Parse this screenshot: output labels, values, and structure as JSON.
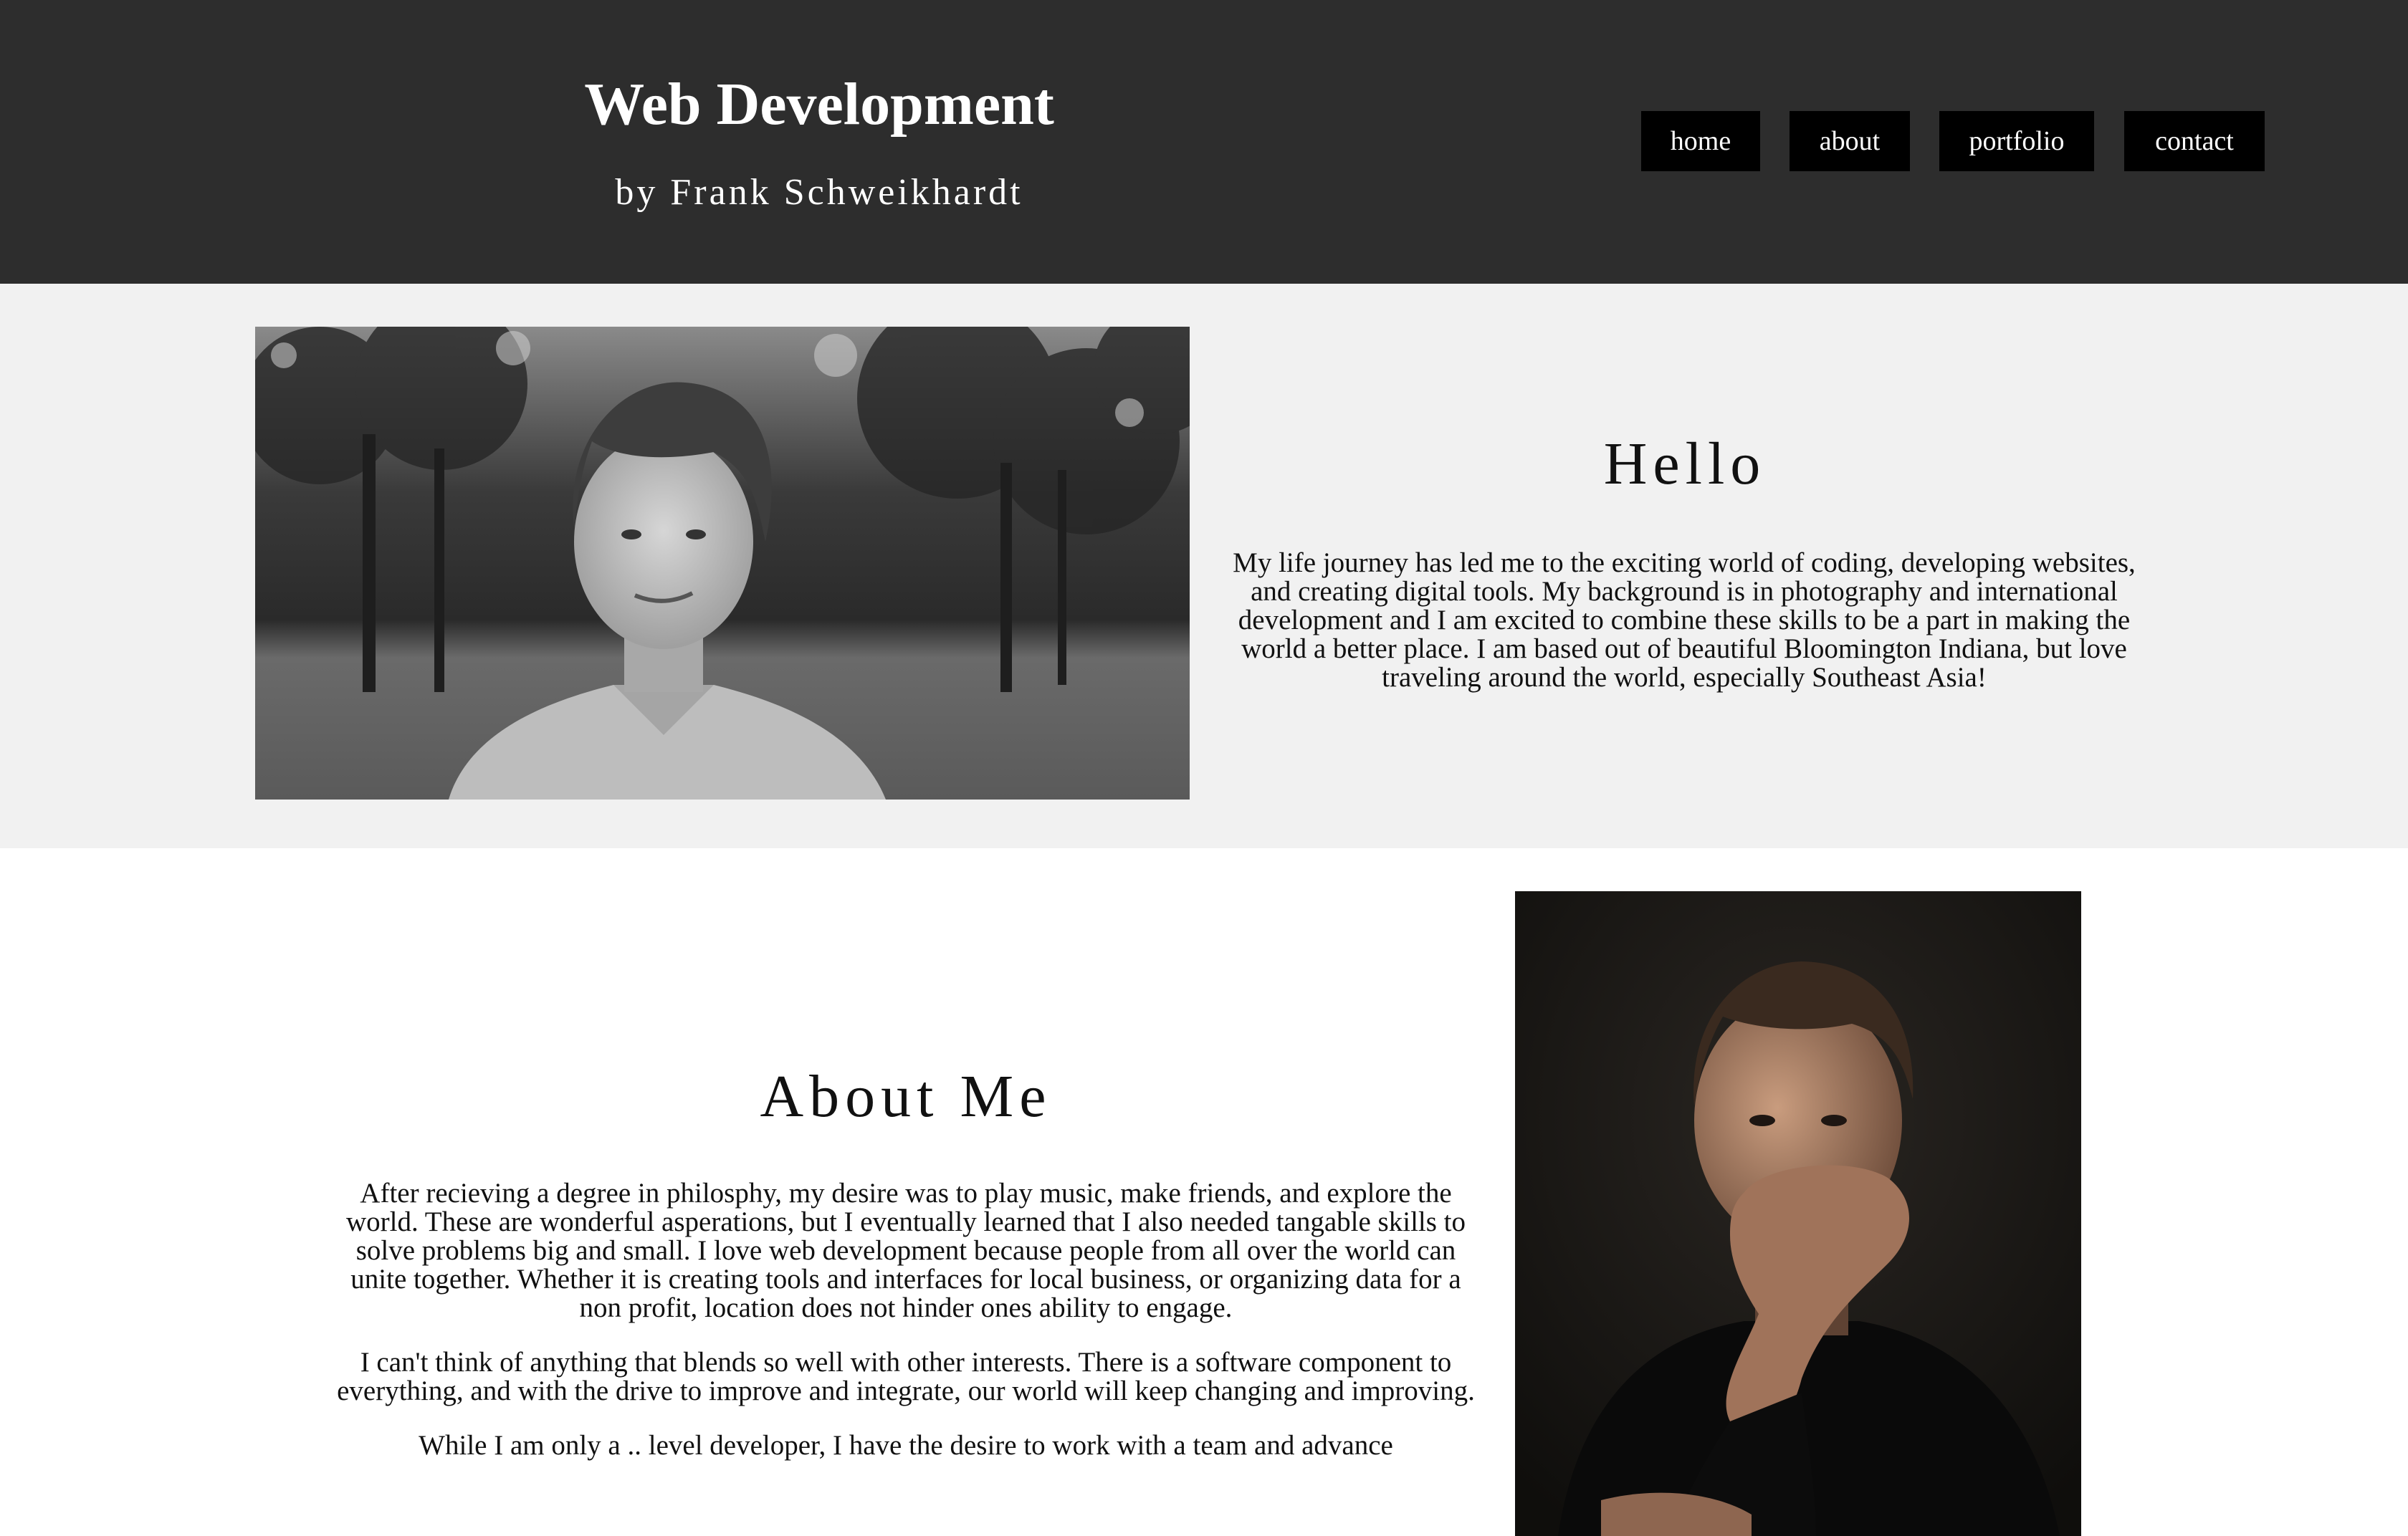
{
  "header": {
    "title": "Web Development",
    "subtitle": "by Frank Schweikhardt",
    "nav": [
      {
        "label": "home"
      },
      {
        "label": "about"
      },
      {
        "label": "portfolio"
      },
      {
        "label": "contact"
      }
    ]
  },
  "hello": {
    "title": "Hello",
    "text": "My life journey has led me to the exciting world of coding, developing websites, and creating digital tools. My background is in photography and international development and I am excited to combine these skills to be a part in making the world a better place. I am based out of beautiful Bloomington Indiana, but love traveling around the world, especially Southeast Asia!"
  },
  "about": {
    "title": "About Me",
    "paragraphs": [
      "After recieving a degree in philosphy, my desire was to play music, make friends, and explore the world. These are wonderful asperations, but I eventually learned that I also needed tangable skills to solve problems big and small. I love web development because people from all over the world can unite together. Whether it is creating tools and interfaces for local business, or organizing data for a non profit, location does not hinder ones ability to engage.",
      "I can't think of anything that blends so well with other interests. There is a software component to everything, and with the drive to improve and integrate, our world will keep changing and improving.",
      "While I am only a .. level developer, I have the desire to work with a team and advance"
    ]
  },
  "colors": {
    "header_bg": "#2d2d2d",
    "nav_button_bg": "#000000",
    "hello_bg": "#f1f1f1",
    "text": "#111111"
  }
}
